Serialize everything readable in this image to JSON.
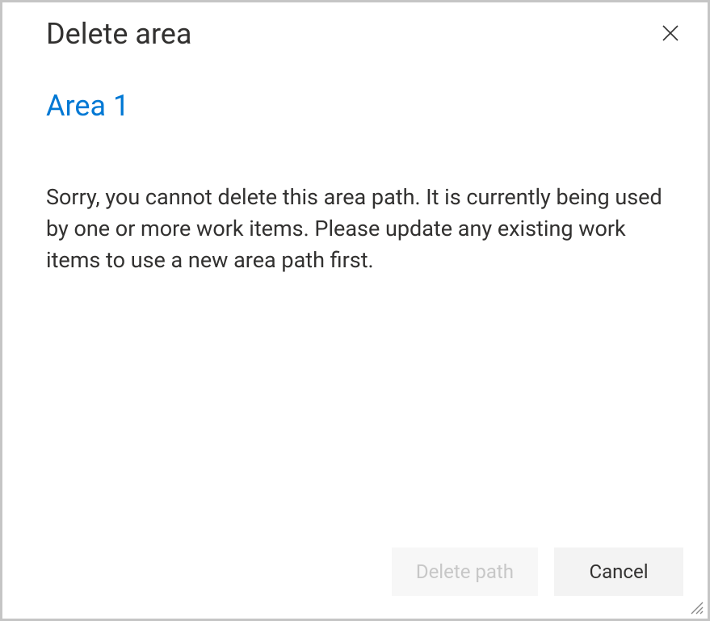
{
  "dialog": {
    "title": "Delete area",
    "subtitle": "Area 1",
    "message": "Sorry, you cannot delete this area path. It is currently being used by one or more work items. Please update any existing work items to use a new area path first.",
    "buttons": {
      "primary": "Delete path",
      "secondary": "Cancel"
    }
  }
}
